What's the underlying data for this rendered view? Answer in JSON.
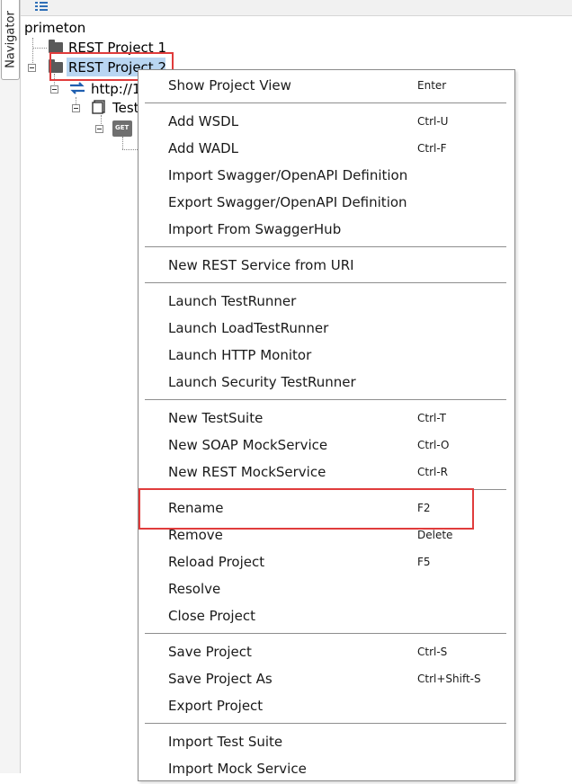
{
  "navigator": {
    "tab_label": "Navigator"
  },
  "tree": {
    "root": "primeton",
    "items": [
      {
        "label": "REST Project 1"
      },
      {
        "label": "REST Project 2"
      },
      {
        "label": "http://1"
      },
      {
        "label": "Test"
      },
      {
        "label": "GET"
      }
    ]
  },
  "menu": {
    "items": [
      {
        "label": "Show Project View",
        "shortcut": "Enter"
      },
      {
        "label": "Add WSDL",
        "shortcut": "Ctrl-U"
      },
      {
        "label": "Add WADL",
        "shortcut": "Ctrl-F"
      },
      {
        "label": "Import Swagger/OpenAPI Definition",
        "shortcut": ""
      },
      {
        "label": "Export Swagger/OpenAPI Definition",
        "shortcut": ""
      },
      {
        "label": "Import From SwaggerHub",
        "shortcut": ""
      },
      {
        "label": "New REST Service from URI",
        "shortcut": ""
      },
      {
        "label": "Launch TestRunner",
        "shortcut": ""
      },
      {
        "label": "Launch LoadTestRunner",
        "shortcut": ""
      },
      {
        "label": "Launch HTTP Monitor",
        "shortcut": ""
      },
      {
        "label": "Launch Security TestRunner",
        "shortcut": ""
      },
      {
        "label": "New TestSuite",
        "shortcut": "Ctrl-T"
      },
      {
        "label": "New SOAP MockService",
        "shortcut": "Ctrl-O"
      },
      {
        "label": "New REST MockService",
        "shortcut": "Ctrl-R"
      },
      {
        "label": "Rename",
        "shortcut": "F2"
      },
      {
        "label": "Remove",
        "shortcut": "Delete"
      },
      {
        "label": "Reload Project",
        "shortcut": "F5"
      },
      {
        "label": "Resolve",
        "shortcut": ""
      },
      {
        "label": "Close Project",
        "shortcut": ""
      },
      {
        "label": "Save Project",
        "shortcut": "Ctrl-S"
      },
      {
        "label": "Save Project As",
        "shortcut": "Ctrl+Shift-S"
      },
      {
        "label": "Export Project",
        "shortcut": ""
      },
      {
        "label": "Import Test Suite",
        "shortcut": ""
      },
      {
        "label": "Import Mock Service",
        "shortcut": ""
      }
    ]
  },
  "colors": {
    "selection": "#b9d6f2",
    "highlight_border": "#e03c3c",
    "separator": "#8e8e8e"
  }
}
